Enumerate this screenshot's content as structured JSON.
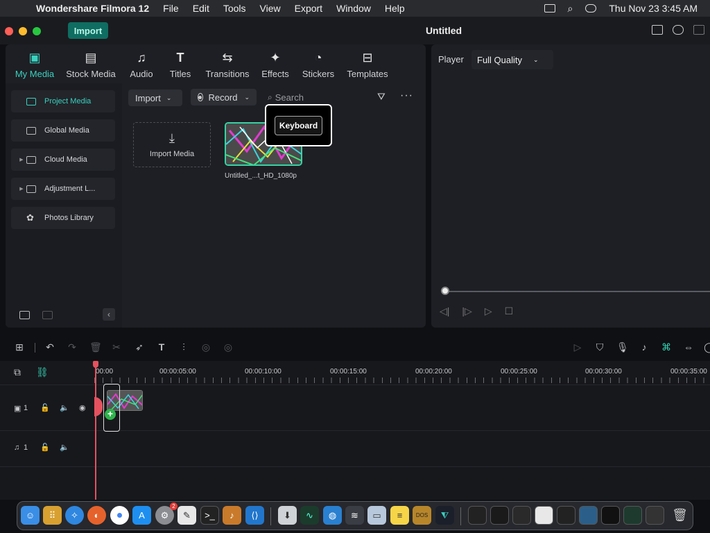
{
  "menubar": {
    "app_name": "Wondershare Filmora 12",
    "menus": [
      "File",
      "Edit",
      "Tools",
      "View",
      "Export",
      "Window",
      "Help"
    ],
    "clock": "Thu Nov 23  3:45 AM"
  },
  "titlebar": {
    "import_button": "Import",
    "project_title": "Untitled"
  },
  "library": {
    "tabs": [
      {
        "label": "My Media",
        "icon": "my-media-icon",
        "active": true
      },
      {
        "label": "Stock Media",
        "icon": "stock-media-icon",
        "active": false
      },
      {
        "label": "Audio",
        "icon": "music-note-icon",
        "active": false
      },
      {
        "label": "Titles",
        "icon": "text-t-icon",
        "active": false
      },
      {
        "label": "Transitions",
        "icon": "transitions-icon",
        "active": false
      },
      {
        "label": "Effects",
        "icon": "effects-sparkle-icon",
        "active": false
      },
      {
        "label": "Stickers",
        "icon": "stickers-icon",
        "active": false
      },
      {
        "label": "Templates",
        "icon": "templates-icon",
        "active": false
      }
    ],
    "sidebar": [
      {
        "label": "Project Media",
        "active": true,
        "expandable": false
      },
      {
        "label": "Global Media",
        "active": false,
        "expandable": false
      },
      {
        "label": "Cloud Media",
        "active": false,
        "expandable": true
      },
      {
        "label": "Adjustment L...",
        "active": false,
        "expandable": true
      },
      {
        "label": "Photos Library",
        "active": false,
        "expandable": false
      }
    ],
    "toolbar": {
      "import_dropdown": "Import",
      "record_dropdown": "Record",
      "search_placeholder": "Search"
    },
    "import_tile_label": "Import Media",
    "clip_name": "Untitled_...t_HD_1080p",
    "tooltip": "Keyboard"
  },
  "player": {
    "label": "Player",
    "quality": "Full Quality"
  },
  "timeline": {
    "ruler_labels": [
      "00:00",
      "00:00:05:00",
      "00:00:10:00",
      "00:00:15:00",
      "00:00:20:00",
      "00:00:25:00",
      "00:00:30:00",
      "00:00:35:00"
    ],
    "tracks": [
      {
        "type": "video",
        "number": "1"
      },
      {
        "type": "audio",
        "number": "1"
      }
    ]
  },
  "colors": {
    "accent": "#3ad1c0",
    "import_button_bg": "#0f6d61",
    "playhead": "#e5515f",
    "clip_border": "#35d3a4"
  },
  "dock": {
    "notification_badge": "2"
  }
}
